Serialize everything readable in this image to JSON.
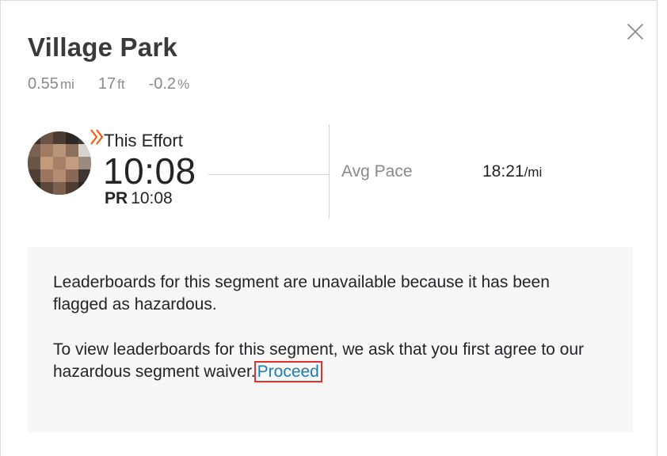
{
  "segment": {
    "title": "Village Park",
    "stats": [
      {
        "value": "0.55",
        "unit": "mi"
      },
      {
        "value": "17",
        "unit": "ft"
      },
      {
        "value": "-0.2",
        "unit": "%"
      }
    ]
  },
  "effort": {
    "label": "This Effort",
    "time": "10:08",
    "pr_badge": "PR",
    "pr_time": "10:08",
    "pace_label": "Avg Pace",
    "pace_value": "18:21",
    "pace_unit": "/mi"
  },
  "notice": {
    "paragraph1": "Leaderboards for this segment are unavailable because it has been flagged as hazardous.",
    "paragraph2": "To view leaderboards for this segment, we ask that you first agree to our hazardous segment waiver.",
    "link_label": "Proceed"
  },
  "colors": {
    "accent": "#fc5200",
    "link": "#1a7fb5",
    "highlight_outline": "#e3322b"
  },
  "icons": {
    "close": "close-icon",
    "effort_chevrons": "double-chevron-icon",
    "avatar": "avatar"
  }
}
